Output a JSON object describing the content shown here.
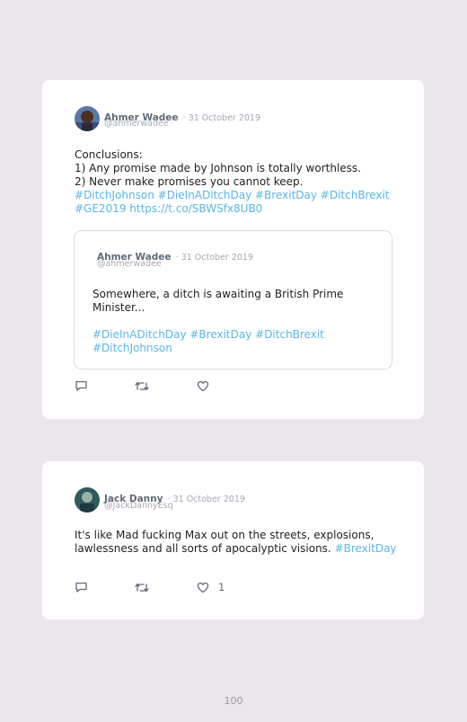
{
  "tweets": [
    {
      "author": "Ahmer Wadee",
      "date": "· 31 October 2019",
      "handle": "@ahmerwadee",
      "lines": [
        "Conclusions:",
        "1) Any promise made by Johnson is totally worthless.",
        "2) Never make promises you cannot keep."
      ],
      "tags_line1": "#DitchJohnson #DieInADitchDay #BrexitDay #DitchBrexit",
      "tags_line2": "#GE2019 https://t.co/SBWSfx8UB0",
      "quote": {
        "author": "Ahmer Wadee",
        "date": "· 31 October 2019",
        "handle": "@ahmerwadee",
        "line1": "Somewhere, a ditch is awaiting a British Prime",
        "line2": "Minister...",
        "tags_line1": "#DieInADitchDay #BrexitDay #DitchBrexit",
        "tags_line2": "#DitchJohnson"
      },
      "actions": {
        "reply_icon": "reply-icon",
        "retweet_icon": "retweet-icon",
        "like_icon": "heart-icon"
      }
    },
    {
      "author": "Jack Danny",
      "date": "· 31 October 2019",
      "handle": "@JackDannyEsq",
      "line1": "It's like Mad fucking Max out on the streets, explosions,",
      "line2": "lawlessness and all sorts of apocalyptic visions.",
      "line2_tag": " #BrexitDay",
      "like_count": "1",
      "actions": {
        "reply_icon": "reply-icon",
        "retweet_icon": "retweet-icon",
        "like_icon": "heart-icon"
      }
    }
  ],
  "page_number": "100",
  "colors": {
    "background": "#ebe6ec",
    "card": "#ffffff",
    "hashtag": "#5bb6e5",
    "name": "#5f6b7a",
    "meta": "#a3a9b1"
  }
}
